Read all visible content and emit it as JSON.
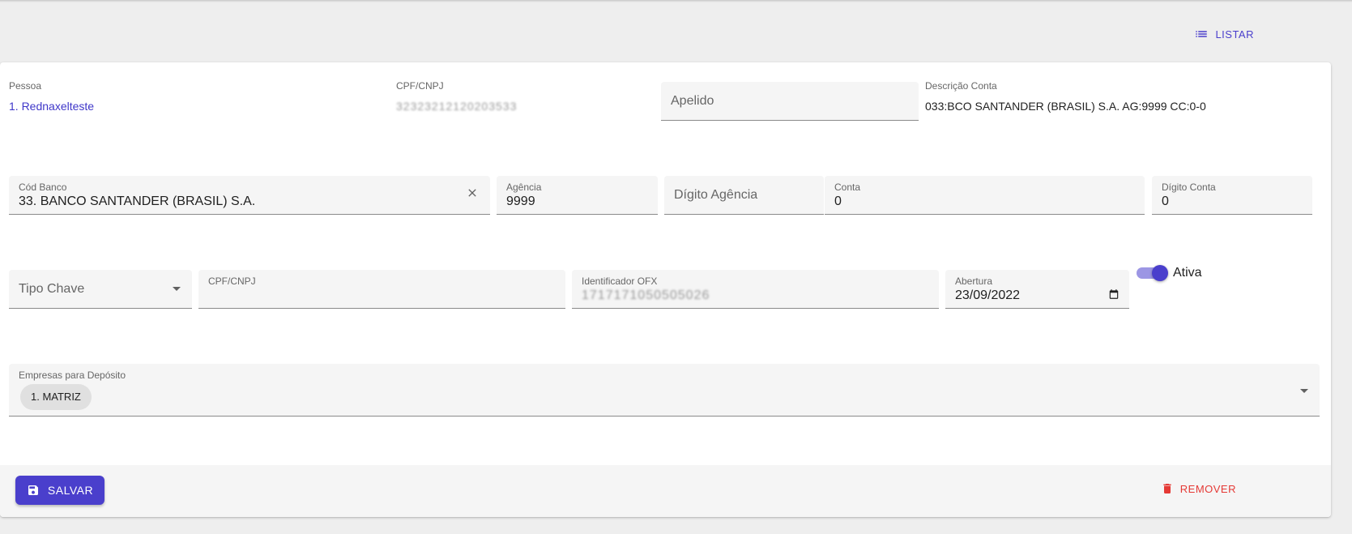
{
  "header": {
    "list_label": "LISTAR"
  },
  "row1": {
    "pessoa_label": "Pessoa",
    "pessoa_value": "1. Rednaxelteste",
    "cpf_label": "CPF/CNPJ",
    "cpf_value": "32323212120203533",
    "apelido_placeholder": "Apelido",
    "descricao_label": "Descrição Conta",
    "descricao_value": "033:BCO SANTANDER (BRASIL) S.A. AG:9999 CC:0-0"
  },
  "row2": {
    "banco_label": "Cód Banco",
    "banco_value": "33. BANCO SANTANDER (BRASIL) S.A.",
    "agencia_label": "Agência",
    "agencia_value": "9999",
    "digito_agencia_placeholder": "Dígito Agência",
    "conta_label": "Conta",
    "conta_value": "0",
    "digito_conta_label": "Dígito Conta",
    "digito_conta_value": "0"
  },
  "row3": {
    "tipo_chave_placeholder": "Tipo Chave",
    "chave_label": "CPF/CNPJ",
    "chave_value": "",
    "ofx_label": "Identificador OFX",
    "ofx_value": "1717171050505026",
    "abertura_label": "Abertura",
    "abertura_value": "23/09/2022",
    "ativa_label": "Ativa",
    "ativa_on": true
  },
  "row4": {
    "empresas_label": "Empresas para Depósito",
    "chips": [
      "1. MATRIZ"
    ]
  },
  "footer": {
    "save_label": "SALVAR",
    "remove_label": "REMOVER"
  },
  "colors": {
    "primary": "#4a3fcc",
    "danger": "#e53935"
  }
}
